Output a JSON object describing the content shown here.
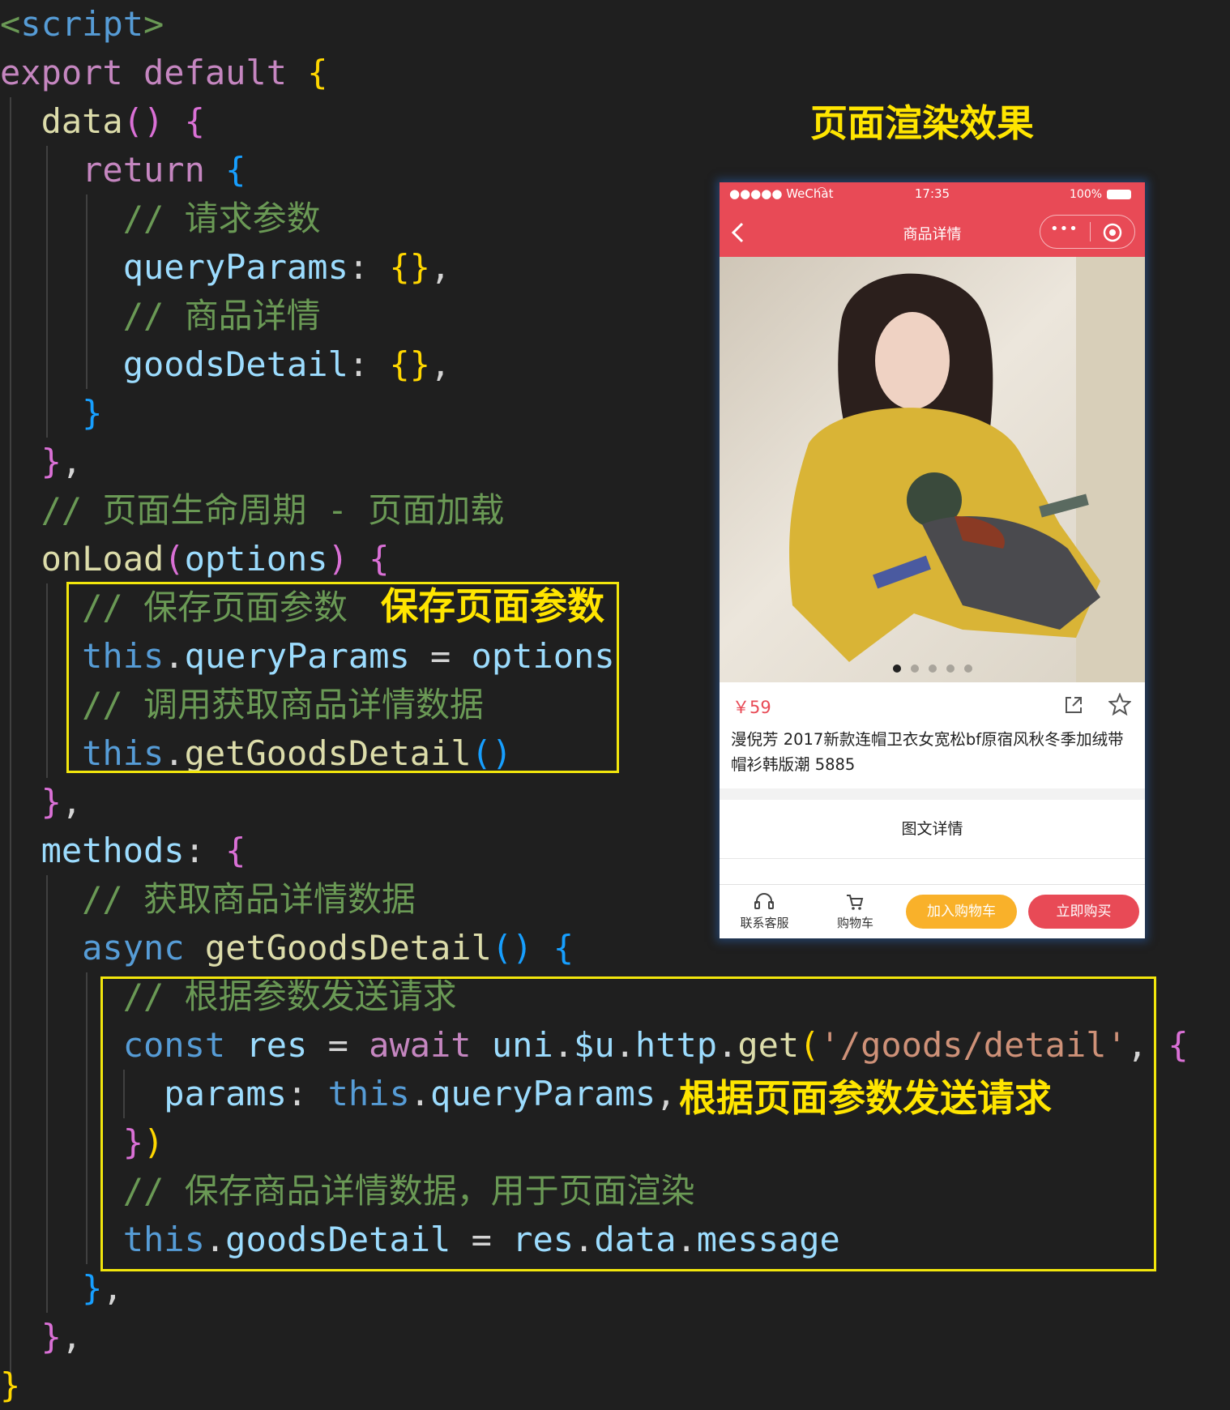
{
  "code_lines": [
    {
      "tokens": [
        {
          "c": "cm",
          "t": "<"
        },
        {
          "c": "th",
          "t": "script"
        },
        {
          "c": "cm",
          "t": ">"
        }
      ]
    },
    {
      "tokens": [
        {
          "c": "kw",
          "t": "export default "
        },
        {
          "c": "by",
          "t": "{"
        }
      ]
    },
    {
      "tokens": [
        {
          "c": "fn",
          "t": "  data"
        },
        {
          "c": "bp",
          "t": "()"
        },
        {
          "c": "",
          "t": " "
        },
        {
          "c": "bp",
          "t": "{"
        }
      ]
    },
    {
      "tokens": [
        {
          "c": "kw",
          "t": "    return "
        },
        {
          "c": "bb",
          "t": "{"
        }
      ]
    },
    {
      "tokens": [
        {
          "c": "cm",
          "t": "      // 请求参数"
        }
      ]
    },
    {
      "tokens": [
        {
          "c": "vr",
          "t": "      queryParams"
        },
        {
          "c": "",
          "t": ": "
        },
        {
          "c": "by",
          "t": "{}"
        },
        {
          "c": "",
          "t": ","
        }
      ]
    },
    {
      "tokens": [
        {
          "c": "cm",
          "t": "      // 商品详情"
        }
      ]
    },
    {
      "tokens": [
        {
          "c": "vr",
          "t": "      goodsDetail"
        },
        {
          "c": "",
          "t": ": "
        },
        {
          "c": "by",
          "t": "{}"
        },
        {
          "c": "",
          "t": ","
        }
      ]
    },
    {
      "tokens": [
        {
          "c": "bb",
          "t": "    }"
        }
      ]
    },
    {
      "tokens": [
        {
          "c": "bp",
          "t": "  }"
        },
        {
          "c": "",
          "t": ","
        }
      ]
    },
    {
      "tokens": [
        {
          "c": "cm",
          "t": "  // 页面生命周期 - 页面加载"
        }
      ]
    },
    {
      "tokens": [
        {
          "c": "fn",
          "t": "  onLoad"
        },
        {
          "c": "bp",
          "t": "("
        },
        {
          "c": "vr",
          "t": "options"
        },
        {
          "c": "bp",
          "t": ")"
        },
        {
          "c": "",
          "t": " "
        },
        {
          "c": "bp",
          "t": "{"
        }
      ]
    },
    {
      "tokens": [
        {
          "c": "cm",
          "t": "    // 保存页面参数"
        }
      ]
    },
    {
      "tokens": [
        {
          "c": "th",
          "t": "    this"
        },
        {
          "c": "",
          "t": "."
        },
        {
          "c": "vr",
          "t": "queryParams"
        },
        {
          "c": "",
          "t": " = "
        },
        {
          "c": "vr",
          "t": "options"
        }
      ]
    },
    {
      "tokens": [
        {
          "c": "cm",
          "t": "    // 调用获取商品详情数据"
        }
      ]
    },
    {
      "tokens": [
        {
          "c": "th",
          "t": "    this"
        },
        {
          "c": "",
          "t": "."
        },
        {
          "c": "fn",
          "t": "getGoodsDetail"
        },
        {
          "c": "bb",
          "t": "()"
        }
      ]
    },
    {
      "tokens": [
        {
          "c": "bp",
          "t": "  }"
        },
        {
          "c": "",
          "t": ","
        }
      ]
    },
    {
      "tokens": [
        {
          "c": "vr",
          "t": "  methods"
        },
        {
          "c": "",
          "t": ": "
        },
        {
          "c": "bp",
          "t": "{"
        }
      ]
    },
    {
      "tokens": [
        {
          "c": "cm",
          "t": "    // 获取商品详情数据"
        }
      ]
    },
    {
      "tokens": [
        {
          "c": "th",
          "t": "    async "
        },
        {
          "c": "fn",
          "t": "getGoodsDetail"
        },
        {
          "c": "bb",
          "t": "()"
        },
        {
          "c": "",
          "t": " "
        },
        {
          "c": "bb",
          "t": "{"
        }
      ]
    },
    {
      "tokens": [
        {
          "c": "cm",
          "t": "      // 根据参数发送请求"
        }
      ]
    },
    {
      "tokens": [
        {
          "c": "th",
          "t": "      const "
        },
        {
          "c": "vr",
          "t": "res"
        },
        {
          "c": "",
          "t": " = "
        },
        {
          "c": "kw",
          "t": "await "
        },
        {
          "c": "vr",
          "t": "uni"
        },
        {
          "c": "",
          "t": "."
        },
        {
          "c": "vr",
          "t": "$u"
        },
        {
          "c": "",
          "t": "."
        },
        {
          "c": "vr",
          "t": "http"
        },
        {
          "c": "",
          "t": "."
        },
        {
          "c": "fn",
          "t": "get"
        },
        {
          "c": "by",
          "t": "("
        },
        {
          "c": "st",
          "t": "'/goods/detail'"
        },
        {
          "c": "",
          "t": ", "
        },
        {
          "c": "bp",
          "t": "{"
        }
      ]
    },
    {
      "tokens": [
        {
          "c": "vr",
          "t": "        params"
        },
        {
          "c": "",
          "t": ": "
        },
        {
          "c": "th",
          "t": "this"
        },
        {
          "c": "",
          "t": "."
        },
        {
          "c": "vr",
          "t": "queryParams"
        },
        {
          "c": "",
          "t": ","
        }
      ]
    },
    {
      "tokens": [
        {
          "c": "bp",
          "t": "      }"
        },
        {
          "c": "by",
          "t": ")"
        }
      ]
    },
    {
      "tokens": [
        {
          "c": "cm",
          "t": "      // 保存商品详情数据，用于页面渲染"
        }
      ]
    },
    {
      "tokens": [
        {
          "c": "th",
          "t": "      this"
        },
        {
          "c": "",
          "t": "."
        },
        {
          "c": "vr",
          "t": "goodsDetail"
        },
        {
          "c": "",
          "t": " = "
        },
        {
          "c": "vr",
          "t": "res"
        },
        {
          "c": "",
          "t": "."
        },
        {
          "c": "vr",
          "t": "data"
        },
        {
          "c": "",
          "t": "."
        },
        {
          "c": "vr",
          "t": "message"
        }
      ]
    },
    {
      "tokens": [
        {
          "c": "bb",
          "t": "    }"
        },
        {
          "c": "",
          "t": ","
        }
      ]
    },
    {
      "tokens": [
        {
          "c": "bp",
          "t": "  }"
        },
        {
          "c": "",
          "t": ","
        }
      ]
    },
    {
      "tokens": [
        {
          "c": "by",
          "t": "}"
        }
      ]
    }
  ],
  "annotations": {
    "render_title": "页面渲染效果",
    "save_params": "保存页面参数",
    "send_request": "根据页面参数发送请求"
  },
  "phone": {
    "status": {
      "carrier": "●●●●● WeChat",
      "time": "17:35",
      "battery": "100%"
    },
    "nav_title": "商品详情",
    "price": "￥59",
    "product_title": "漫倪芳 2017新款连帽卫衣女宽松bf原宿风秋冬季加绒带帽衫韩版潮 5885",
    "detail_tab": "图文详情",
    "footer": {
      "service": "联系客服",
      "cart": "购物车",
      "add_cart": "加入购物车",
      "buy_now": "立即购买"
    },
    "colors": {
      "brand": "#e84a56",
      "add_cart": "#f9b12a",
      "buy_now": "#e84a56"
    }
  }
}
